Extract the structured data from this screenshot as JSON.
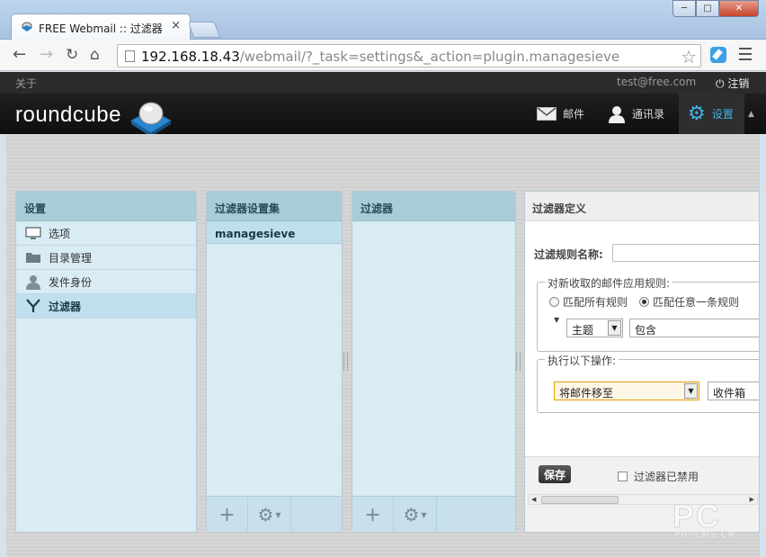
{
  "browser": {
    "tab_title": "FREE Webmail :: 过滤器",
    "tab_close": "×",
    "url_host": "192.168.18.43",
    "url_path": "/webmail/?_task=settings&_action=plugin.managesieve"
  },
  "topbar": {
    "about": "关于",
    "username": "test@free.com",
    "logout": "注销"
  },
  "header": {
    "logo": "roundcube",
    "tasks": [
      {
        "label": "邮件",
        "icon": "envelope-icon"
      },
      {
        "label": "通讯录",
        "icon": "contacts-icon"
      },
      {
        "label": "设置",
        "icon": "gear-icon",
        "selected": true
      }
    ]
  },
  "settings_panel": {
    "title": "设置",
    "items": [
      {
        "label": "选项",
        "icon": "monitor-icon"
      },
      {
        "label": "目录管理",
        "icon": "folder-icon"
      },
      {
        "label": "发件身份",
        "icon": "person-icon"
      },
      {
        "label": "过滤器",
        "icon": "filter-icon",
        "selected": true
      }
    ]
  },
  "filtersets_panel": {
    "title": "过滤器设置集",
    "sets": [
      "managesieve"
    ]
  },
  "filters_panel": {
    "title": "过滤器"
  },
  "definition": {
    "title": "过滤器定义",
    "name_label": "过滤规则名称:",
    "name_value": "",
    "rules_legend": "对新收取的邮件应用规则:",
    "radio_all": "匹配所有规则",
    "radio_any": "匹配任意一条规则",
    "rule_header": "主题",
    "rule_op": "包含",
    "actions_legend": "执行以下操作:",
    "action": "将邮件移至",
    "target_folder": "收件箱",
    "save_label": "保存",
    "disabled_label": "过滤器已禁用"
  },
  "watermark": {
    "big": "PC",
    "small": "PHPCMS.CN"
  },
  "colors": {
    "panel_header": "#a9ccd9",
    "panel_body": "#d9ebf3",
    "selected_row": "#bfdfec",
    "accent": "#3fb4e6",
    "header_bg": "#1a1a1a"
  }
}
